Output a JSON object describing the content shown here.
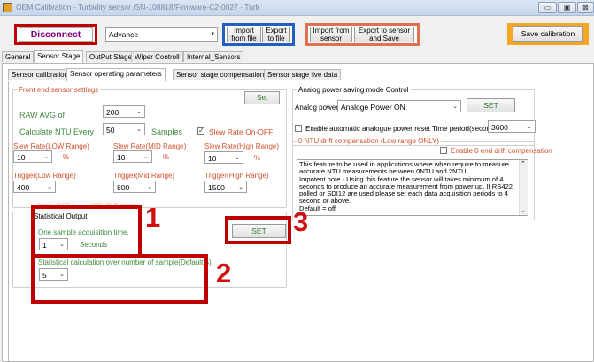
{
  "window": {
    "title": "OEM Calibration - Turbidity sensor /SN-108818/Firmware-C2-0027 - Turb",
    "min": "▭",
    "max": "▣",
    "close": "⊠"
  },
  "toolbar": {
    "disconnect": "Disconnect",
    "mode_value": "Advance",
    "import_file": "Import from file",
    "export_file": "Export to file",
    "import_sensor": "Import from sensor",
    "export_sensor": "Export to sensor and Save",
    "save_calibration": "Save calibration"
  },
  "main_tabs": [
    "General",
    "Sensor Stage",
    "OutPut Stage",
    "Wiper Controll",
    "Internal_Sensors"
  ],
  "sub_tabs": [
    "Sensor calibrations.",
    "Sensor operating parameters",
    "Sensor stage compensations.",
    "Sensor stage live data"
  ],
  "front_end": {
    "caption": "Front end sensor settings",
    "set": "Set",
    "raw_avg_label": "RAW AVG of",
    "raw_avg_value": "200",
    "calc_ntu_label": "Calculate NTU Every",
    "calc_ntu_value": "50",
    "samples_label": "Samples",
    "slew_onoff_label": "Slew Rate On-OFF",
    "slew_low_label": "Slew Rate(LOW Range)",
    "slew_mid_label": "Slew Rate(MID Range)",
    "slew_high_label": "Slew Rate(High Range)",
    "slew_low_value": "10",
    "slew_mid_value": "10",
    "slew_high_value": "10",
    "percent": "%",
    "trig_low_label": "Trigger(Low Range)",
    "trig_mid_label": "Trigger(Mid Range)",
    "trig_high_label": "Trigger(High Range)",
    "trig_low_value": "400",
    "trig_mid_value": "800",
    "trig_high_value": "1500",
    "note": "Note 1NTU ---- 1000 @ Eprom"
  },
  "statistical": {
    "caption": "Statistical Output",
    "acq_label": "One sample acquisition time.",
    "acq_value": "1",
    "seconds": "Seconds",
    "set": "SET",
    "calc_label": "Statistical calculation over number of sample(Default 5).",
    "calc_value": "5"
  },
  "power": {
    "caption": "Analog power saving mode Control",
    "label": "Analog power",
    "value": "Analoge Power ON",
    "set": "SET",
    "auto_reset_label": "Enable automatic analogue power reset",
    "time_period_label": "Time period(seconds)",
    "time_period_value": "3600"
  },
  "drift": {
    "caption": "0 NTU drift compensation (Low range ONLY)",
    "enable_label": "Enable 0 end drift compensation",
    "text": "This feature to be used in applications where when require to measure accurate NTU measurements between 0NTU and 2NTU.\nImpotent note - Using this feature the sensor will takes minimum of 4 seconds to produce an accurate measurement from power up. If RS422 polled or SDI12 are used please set each data acquisition periods to 4 second or above.\nDefault = off"
  },
  "annotations": {
    "n1": "1",
    "n2": "2",
    "n3": "3"
  },
  "colors": {
    "disconnect_border": "#c00000",
    "file_border": "#2060c0",
    "sensor_border": "#e07050",
    "save_bg": "#f5a623",
    "annotation": "#c00000"
  }
}
